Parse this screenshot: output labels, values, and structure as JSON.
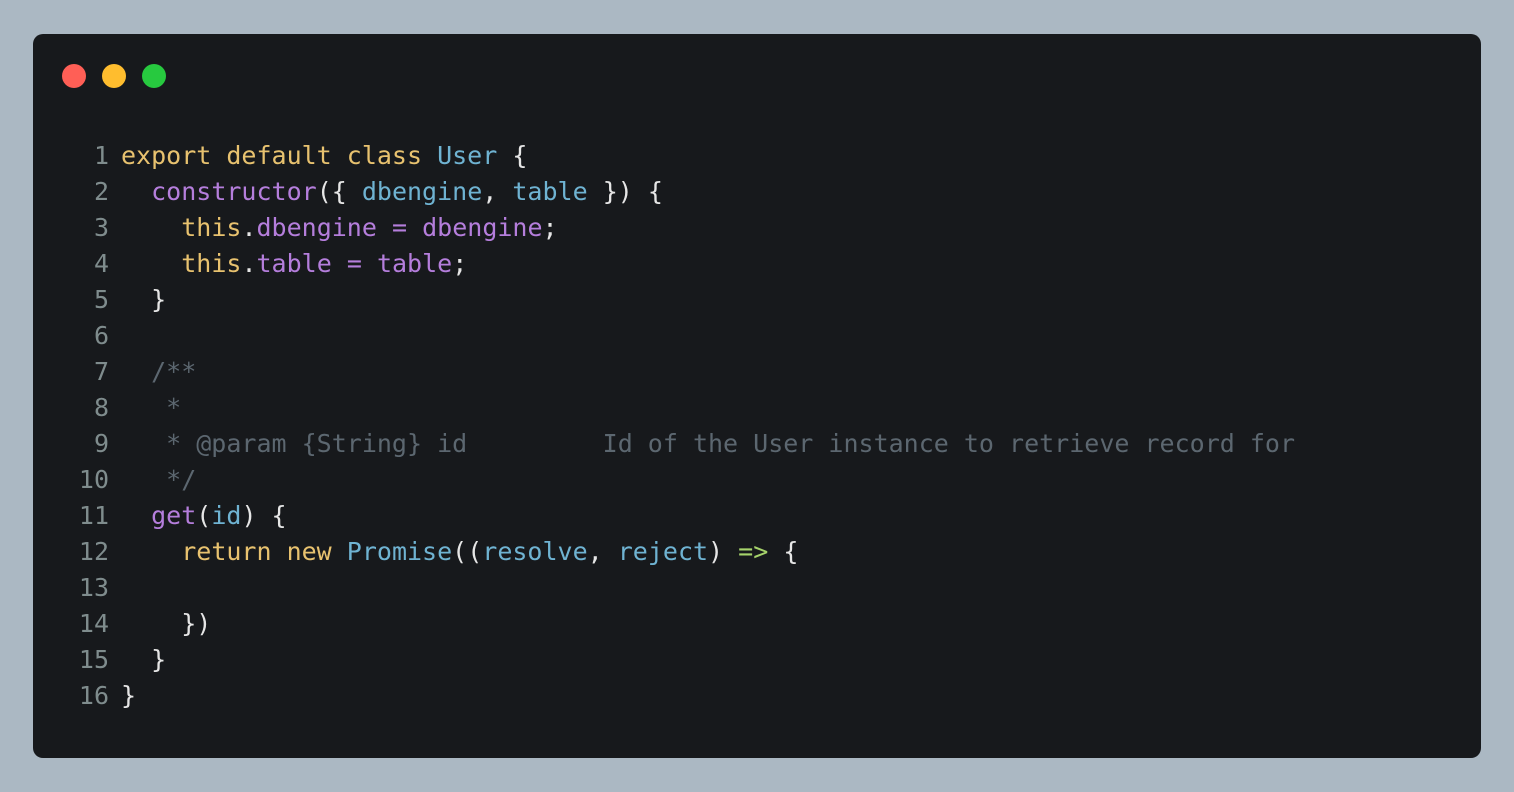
{
  "window": {
    "controls": {
      "close_color": "#ff5f56",
      "minimize_color": "#ffbd2e",
      "zoom_color": "#27c93f"
    }
  },
  "editor": {
    "language": "javascript",
    "theme_colors": {
      "background": "#17191c",
      "keyword": "#e8c26f",
      "class_name": "#6fb3d2",
      "function": "#b57edc",
      "comment": "#5c6770",
      "arrow": "#a6d36b",
      "line_number": "#7f8c8d"
    },
    "lines": [
      {
        "n": "1",
        "indent": "",
        "tokens": [
          [
            "kw",
            "export default class "
          ],
          [
            "cls",
            "User"
          ],
          [
            "punc",
            " {"
          ]
        ]
      },
      {
        "n": "2",
        "indent": "  ",
        "tokens": [
          [
            "fn",
            "constructor"
          ],
          [
            "punc",
            "({ "
          ],
          [
            "param",
            "dbengine"
          ],
          [
            "punc",
            ", "
          ],
          [
            "param",
            "table"
          ],
          [
            "punc",
            " }) {"
          ]
        ]
      },
      {
        "n": "3",
        "indent": "    ",
        "tokens": [
          [
            "kw",
            "this"
          ],
          [
            "punc",
            "."
          ],
          [
            "prop",
            "dbengine"
          ],
          [
            "punc",
            " "
          ],
          [
            "prop",
            "="
          ],
          [
            "punc",
            " "
          ],
          [
            "prop",
            "dbengine"
          ],
          [
            "punc",
            ";"
          ]
        ]
      },
      {
        "n": "4",
        "indent": "    ",
        "tokens": [
          [
            "kw",
            "this"
          ],
          [
            "punc",
            "."
          ],
          [
            "prop",
            "table"
          ],
          [
            "punc",
            " "
          ],
          [
            "prop",
            "="
          ],
          [
            "punc",
            " "
          ],
          [
            "prop",
            "table"
          ],
          [
            "punc",
            ";"
          ]
        ]
      },
      {
        "n": "5",
        "indent": "  ",
        "tokens": [
          [
            "punc",
            "}"
          ]
        ]
      },
      {
        "n": "6",
        "indent": "",
        "tokens": []
      },
      {
        "n": "7",
        "indent": "  ",
        "tokens": [
          [
            "cm",
            "/**"
          ]
        ]
      },
      {
        "n": "8",
        "indent": "   ",
        "tokens": [
          [
            "cm",
            "*"
          ]
        ]
      },
      {
        "n": "9",
        "indent": "   ",
        "tokens": [
          [
            "cm",
            "* @param {String} id         Id of the User instance to retrieve record for"
          ]
        ]
      },
      {
        "n": "10",
        "indent": "   ",
        "tokens": [
          [
            "cm",
            "*/"
          ]
        ]
      },
      {
        "n": "11",
        "indent": "  ",
        "tokens": [
          [
            "fn",
            "get"
          ],
          [
            "punc",
            "("
          ],
          [
            "param",
            "id"
          ],
          [
            "punc",
            ") {"
          ]
        ]
      },
      {
        "n": "12",
        "indent": "    ",
        "tokens": [
          [
            "kw",
            "return new "
          ],
          [
            "cls",
            "Promise"
          ],
          [
            "punc",
            "(("
          ],
          [
            "param",
            "resolve"
          ],
          [
            "punc",
            ", "
          ],
          [
            "param",
            "reject"
          ],
          [
            "punc",
            ") "
          ],
          [
            "arrow",
            "=>"
          ],
          [
            "punc",
            " {"
          ]
        ]
      },
      {
        "n": "13",
        "indent": "",
        "tokens": []
      },
      {
        "n": "14",
        "indent": "    ",
        "tokens": [
          [
            "punc",
            "})"
          ]
        ]
      },
      {
        "n": "15",
        "indent": "  ",
        "tokens": [
          [
            "punc",
            "}"
          ]
        ]
      },
      {
        "n": "16",
        "indent": "",
        "tokens": [
          [
            "punc",
            "}"
          ]
        ]
      }
    ]
  }
}
